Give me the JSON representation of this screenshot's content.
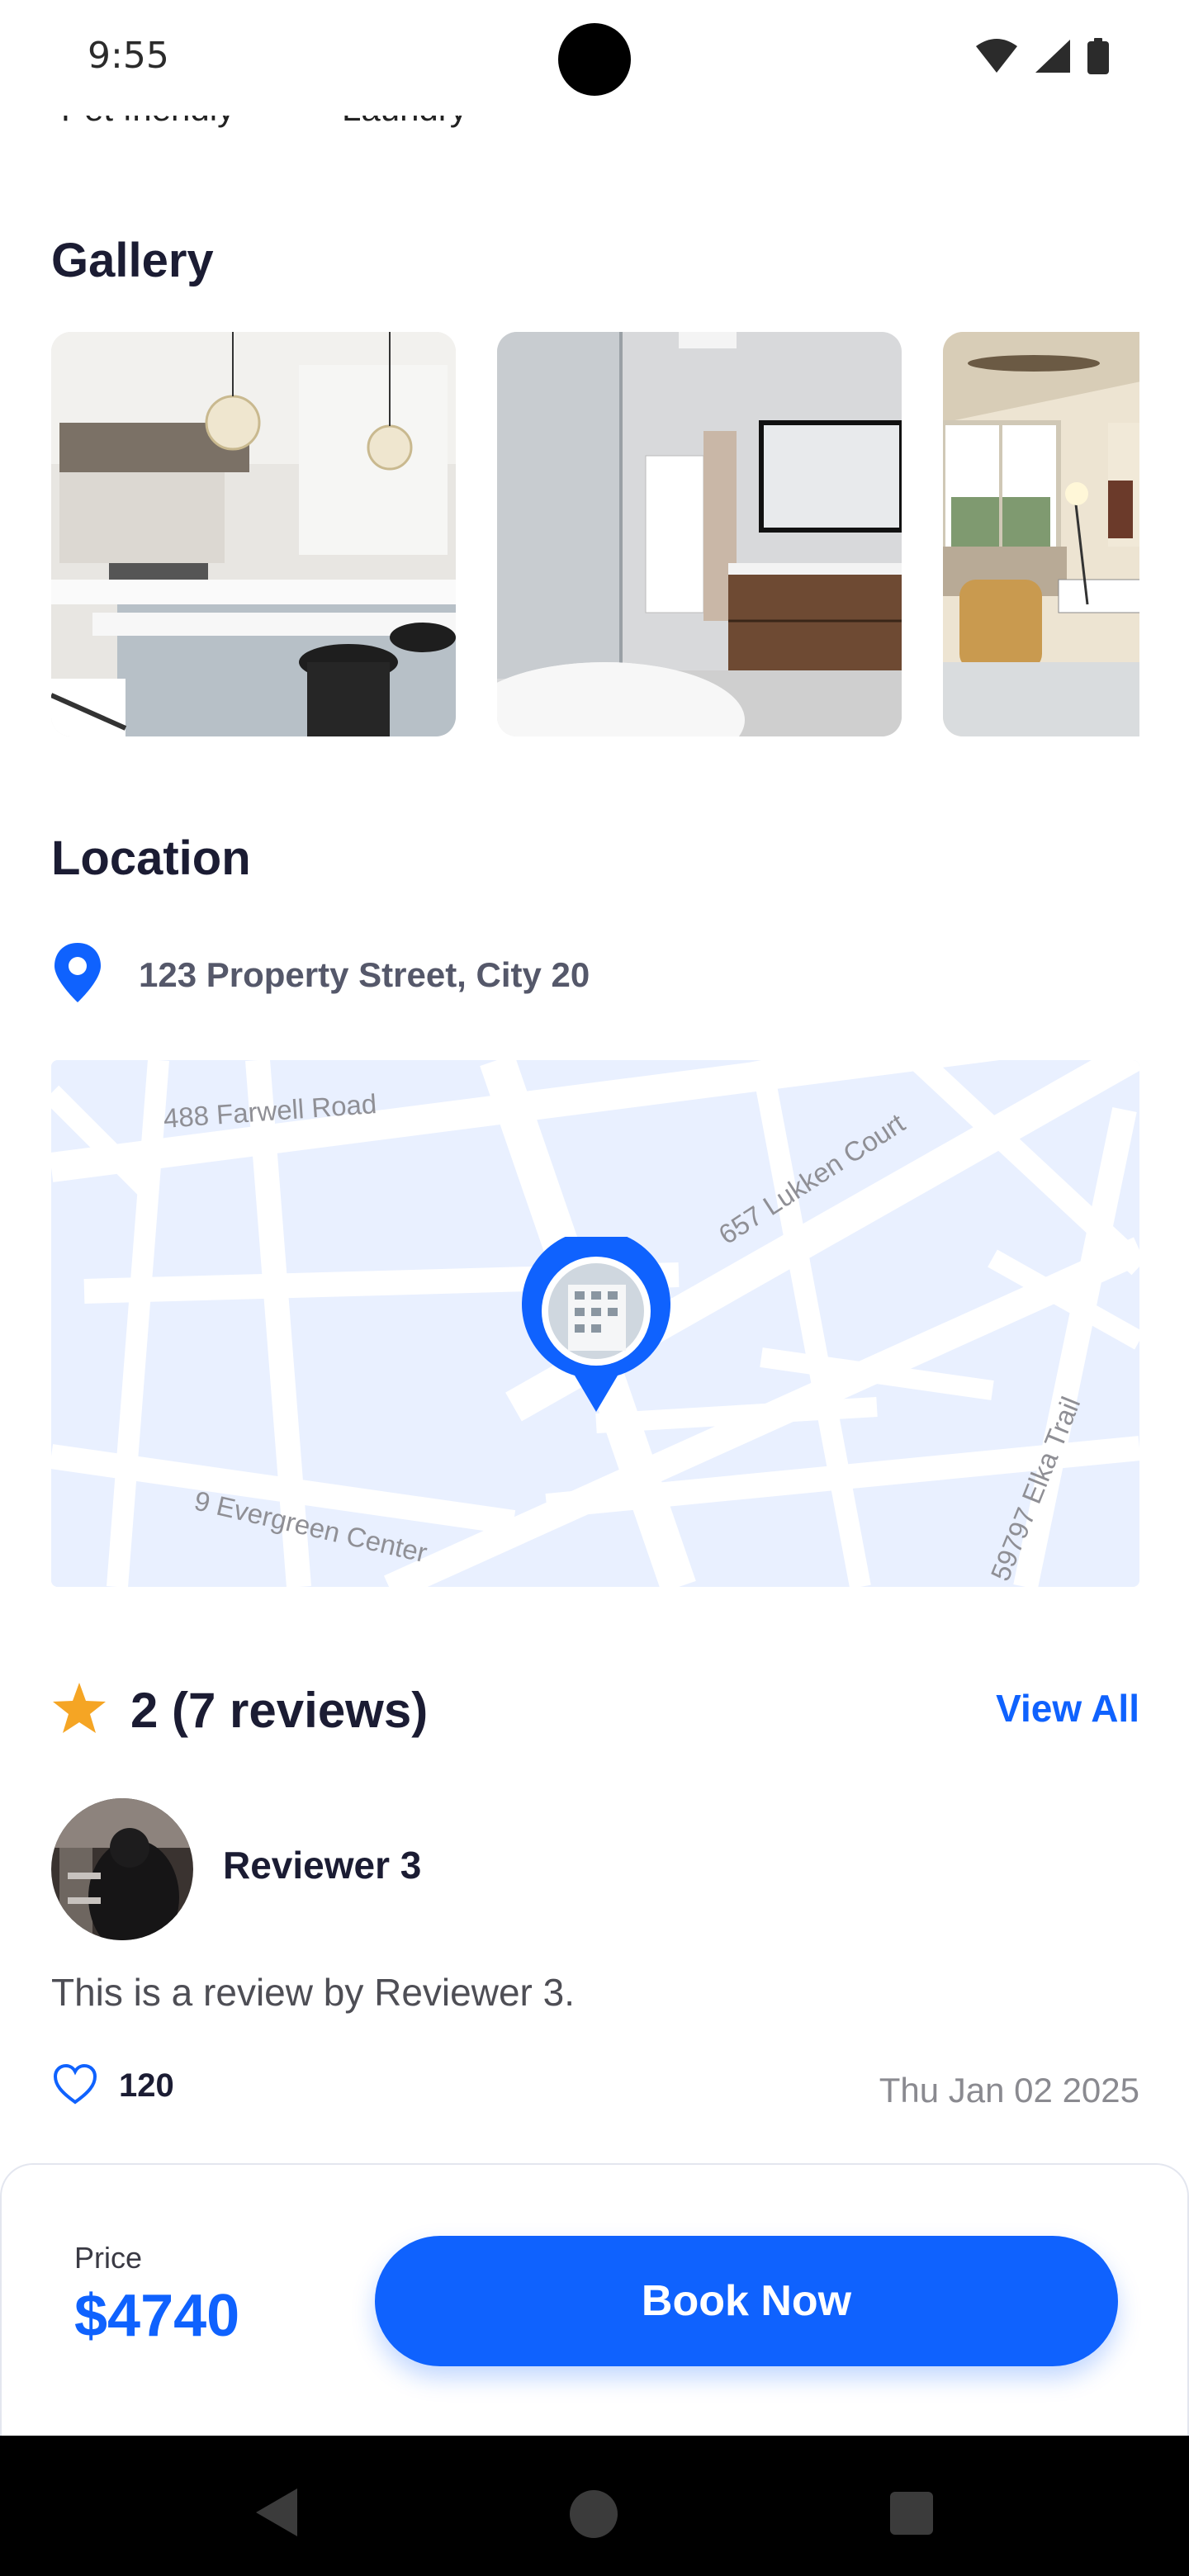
{
  "status_bar": {
    "time": "9:55"
  },
  "amenities_cut": [
    "Pet friendly",
    "Laundry"
  ],
  "gallery": {
    "title": "Gallery",
    "images": [
      {
        "alt": "kitchen"
      },
      {
        "alt": "bathroom"
      },
      {
        "alt": "living room"
      }
    ]
  },
  "location": {
    "title": "Location",
    "address": "123 Property Street, City 20",
    "map_labels": {
      "road1": "488 Farwell Road",
      "road2": "657 Lukken Court",
      "road3": "9 Evergreen Center",
      "road4": "59797 Elka Trail"
    }
  },
  "reviews": {
    "summary": "2 (7 reviews)",
    "view_all": "View All",
    "items": [
      {
        "name": "Reviewer 3",
        "text": "This is a review by Reviewer 3.",
        "likes": "120",
        "date": "Thu Jan 02 2025"
      }
    ]
  },
  "booking": {
    "price_label": "Price",
    "price": "$4740",
    "button": "Book Now"
  },
  "colors": {
    "accent": "#0f62fe",
    "star": "#f5a524",
    "map_bg": "#e9f0ff"
  }
}
